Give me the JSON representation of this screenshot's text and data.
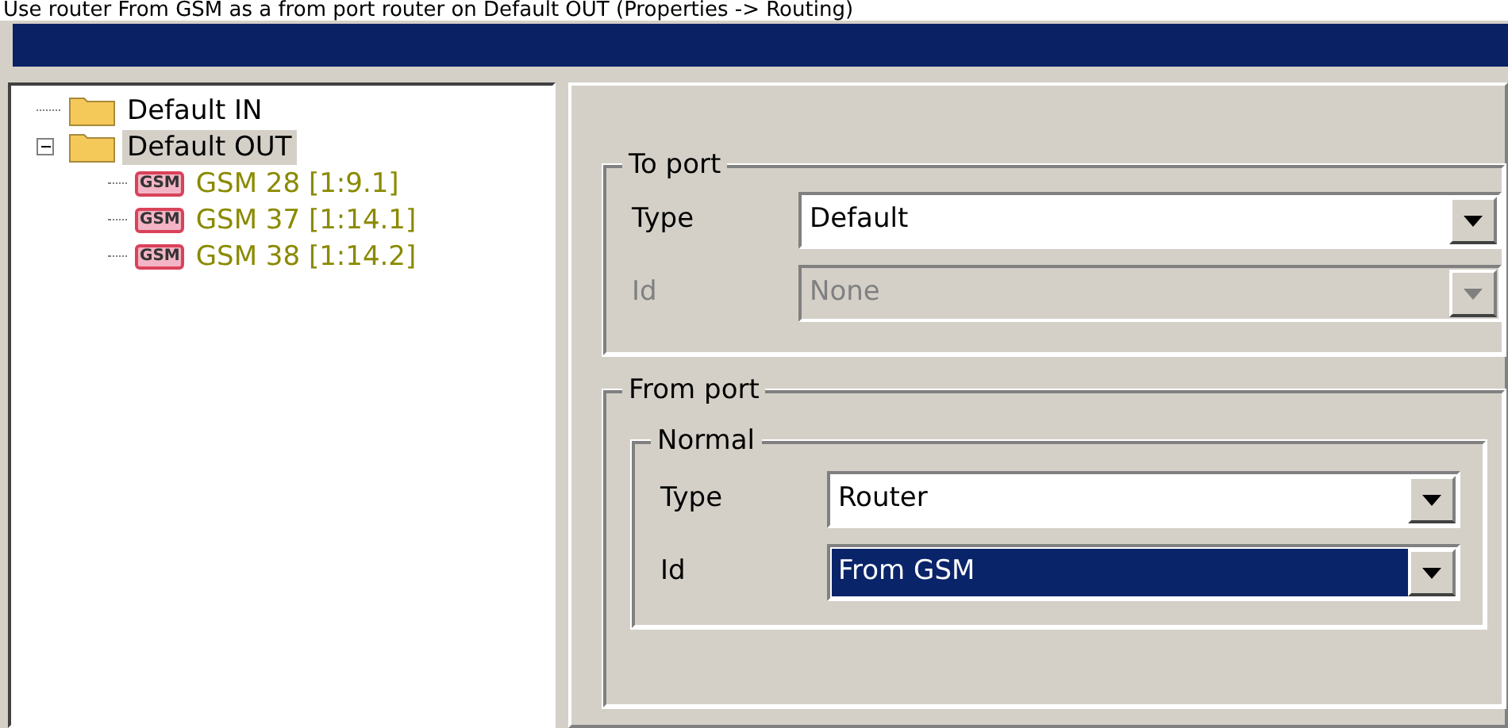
{
  "caption": "Use router From GSM as a from port router on Default OUT (Properties -> Routing)",
  "tree": [
    {
      "label": "Default IN",
      "kind": "folder",
      "selected": false
    },
    {
      "label": "Default OUT",
      "kind": "folder",
      "selected": true,
      "expanded": true,
      "children": [
        {
          "label": "GSM 28 [1:9.1]",
          "kind": "gsm",
          "selected": false,
          "icon_text": "GSM"
        },
        {
          "label": "GSM 37 [1:14.1]",
          "kind": "gsm",
          "selected": false,
          "icon_text": "GSM"
        },
        {
          "label": "GSM 38 [1:14.2]",
          "kind": "gsm",
          "selected": false,
          "icon_text": "GSM"
        }
      ]
    }
  ],
  "to_port": {
    "title": "To port",
    "fields": [
      {
        "label": "Type",
        "value": "Default",
        "disabled": false,
        "highlighted": false
      },
      {
        "label": "Id",
        "value": "None",
        "disabled": true,
        "highlighted": false
      }
    ]
  },
  "from_port": {
    "title": "From port",
    "group": {
      "title": "Normal",
      "fields": [
        {
          "label": "Type",
          "value": "Router",
          "disabled": false,
          "highlighted": false
        },
        {
          "label": "Id",
          "value": "From GSM",
          "disabled": false,
          "highlighted": true
        }
      ]
    }
  }
}
